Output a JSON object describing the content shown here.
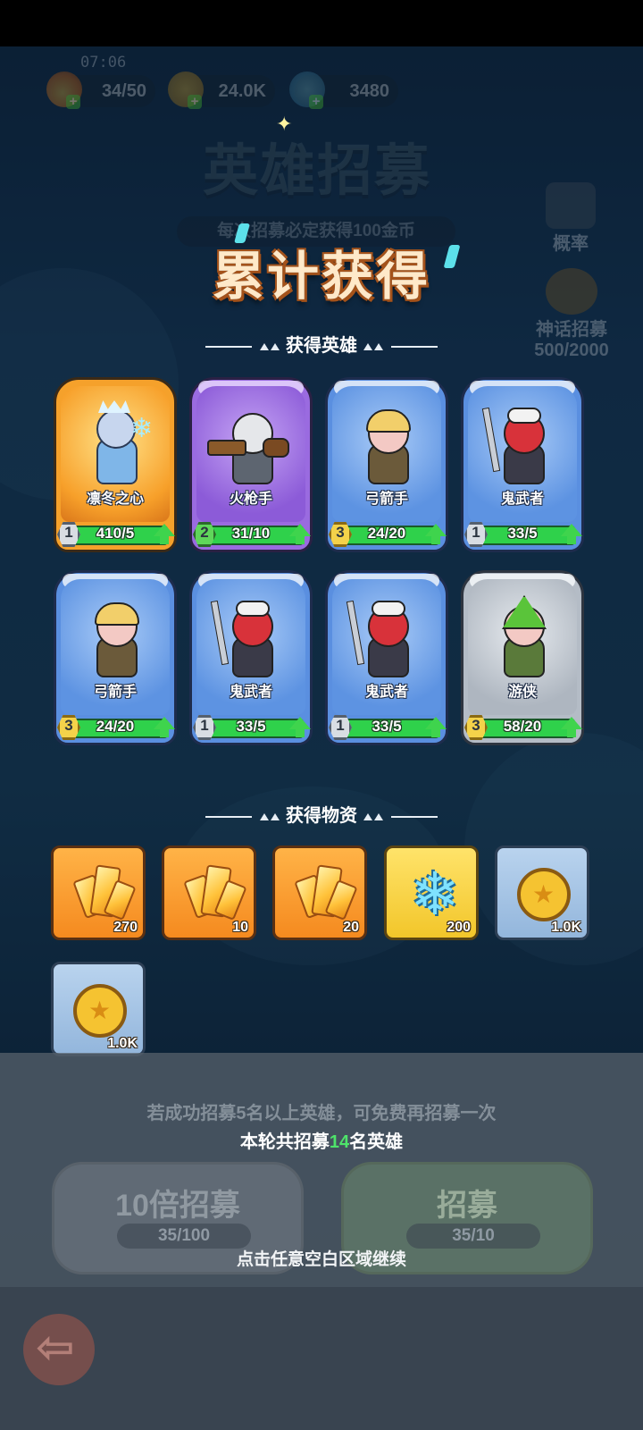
{
  "status": {
    "time": "07:06"
  },
  "resources": {
    "energy": "34/50",
    "gold": "24.0K",
    "gems": "3480"
  },
  "background": {
    "title": "英雄招募",
    "subtitle": "每次招募必定获得100金币",
    "probability_label": "概率",
    "mythic_label": "神话招募",
    "mythic_progress": "500/2000"
  },
  "rewards": {
    "title": "累计获得",
    "heroes_header": "获得英雄",
    "items_header": "获得物资"
  },
  "heroes": [
    {
      "name": "凛冬之心",
      "level": "1",
      "count": "410/5",
      "rarity": "legendary"
    },
    {
      "name": "火枪手",
      "level": "2",
      "count": "31/10",
      "rarity": "epic"
    },
    {
      "name": "弓箭手",
      "level": "3",
      "count": "24/20",
      "rarity": "rare"
    },
    {
      "name": "鬼武者",
      "level": "1",
      "count": "33/5",
      "rarity": "rare"
    },
    {
      "name": "弓箭手",
      "level": "3",
      "count": "24/20",
      "rarity": "rare"
    },
    {
      "name": "鬼武者",
      "level": "1",
      "count": "33/5",
      "rarity": "rare"
    },
    {
      "name": "鬼武者",
      "level": "1",
      "count": "33/5",
      "rarity": "rare"
    },
    {
      "name": "游侠",
      "level": "3",
      "count": "58/20",
      "rarity": "common"
    }
  ],
  "items": [
    {
      "icon": "gold-crystal",
      "qty": "270"
    },
    {
      "icon": "gold-crystal",
      "qty": "10"
    },
    {
      "icon": "gold-crystal",
      "qty": "20"
    },
    {
      "icon": "ice-crystal",
      "qty": "200"
    },
    {
      "icon": "gold-coin",
      "qty": "1.0K"
    },
    {
      "icon": "gold-coin",
      "qty": "1.0K"
    }
  ],
  "bottom": {
    "hint": "若成功招募5名以上英雄，可免费再招募一次",
    "summary_prefix": "本轮共招募",
    "summary_count": "14",
    "summary_suffix": "名英雄",
    "ten_label": "10倍招募",
    "ten_cost": "35/100",
    "recruit_label": "招募",
    "recruit_cost": "35/10",
    "continue": "点击任意空白区域继续"
  },
  "colors": {
    "accent_green": "#4ee36a",
    "legendary": "#f5a12b",
    "epic": "#9a6be0",
    "rare": "#5a8fe0",
    "common": "#b4bcc6"
  }
}
